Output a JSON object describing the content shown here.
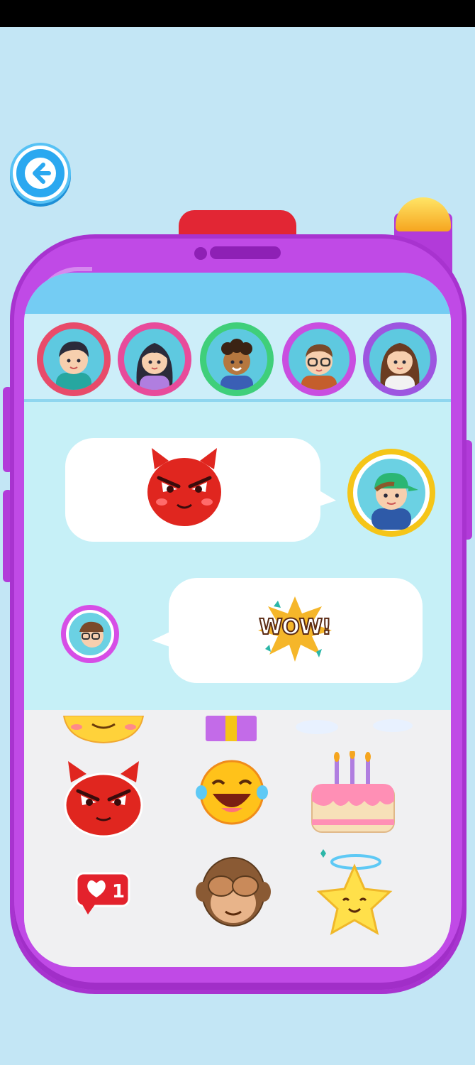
{
  "screen": {
    "back_button": {
      "icon": "arrow-left-icon"
    },
    "contacts": [
      {
        "name": "contact-boy-1",
        "ring": "#e84b6a"
      },
      {
        "name": "contact-girl-1",
        "ring": "#e84b9b"
      },
      {
        "name": "contact-boy-2",
        "ring": "#3fcf7a"
      },
      {
        "name": "contact-man-glasses",
        "ring": "#c94ee0"
      },
      {
        "name": "contact-girl-2",
        "ring": "#9d55e0"
      }
    ],
    "messages": [
      {
        "from": "contact",
        "sticker": "devil-emoji",
        "avatar": "boy-cap-avatar"
      },
      {
        "from": "me",
        "sticker": "wow-sticker",
        "sticker_text": "WOW!",
        "avatar": "man-glasses-avatar"
      }
    ],
    "sticker_tray": {
      "items": [
        "smile-emoji",
        "gift-box",
        "cloud",
        "devil-emoji",
        "laughing-emoji",
        "birthday-cake",
        "like-badge",
        "see-no-evil-monkey",
        "star-emoji"
      ],
      "like_badge_count": "1"
    }
  }
}
